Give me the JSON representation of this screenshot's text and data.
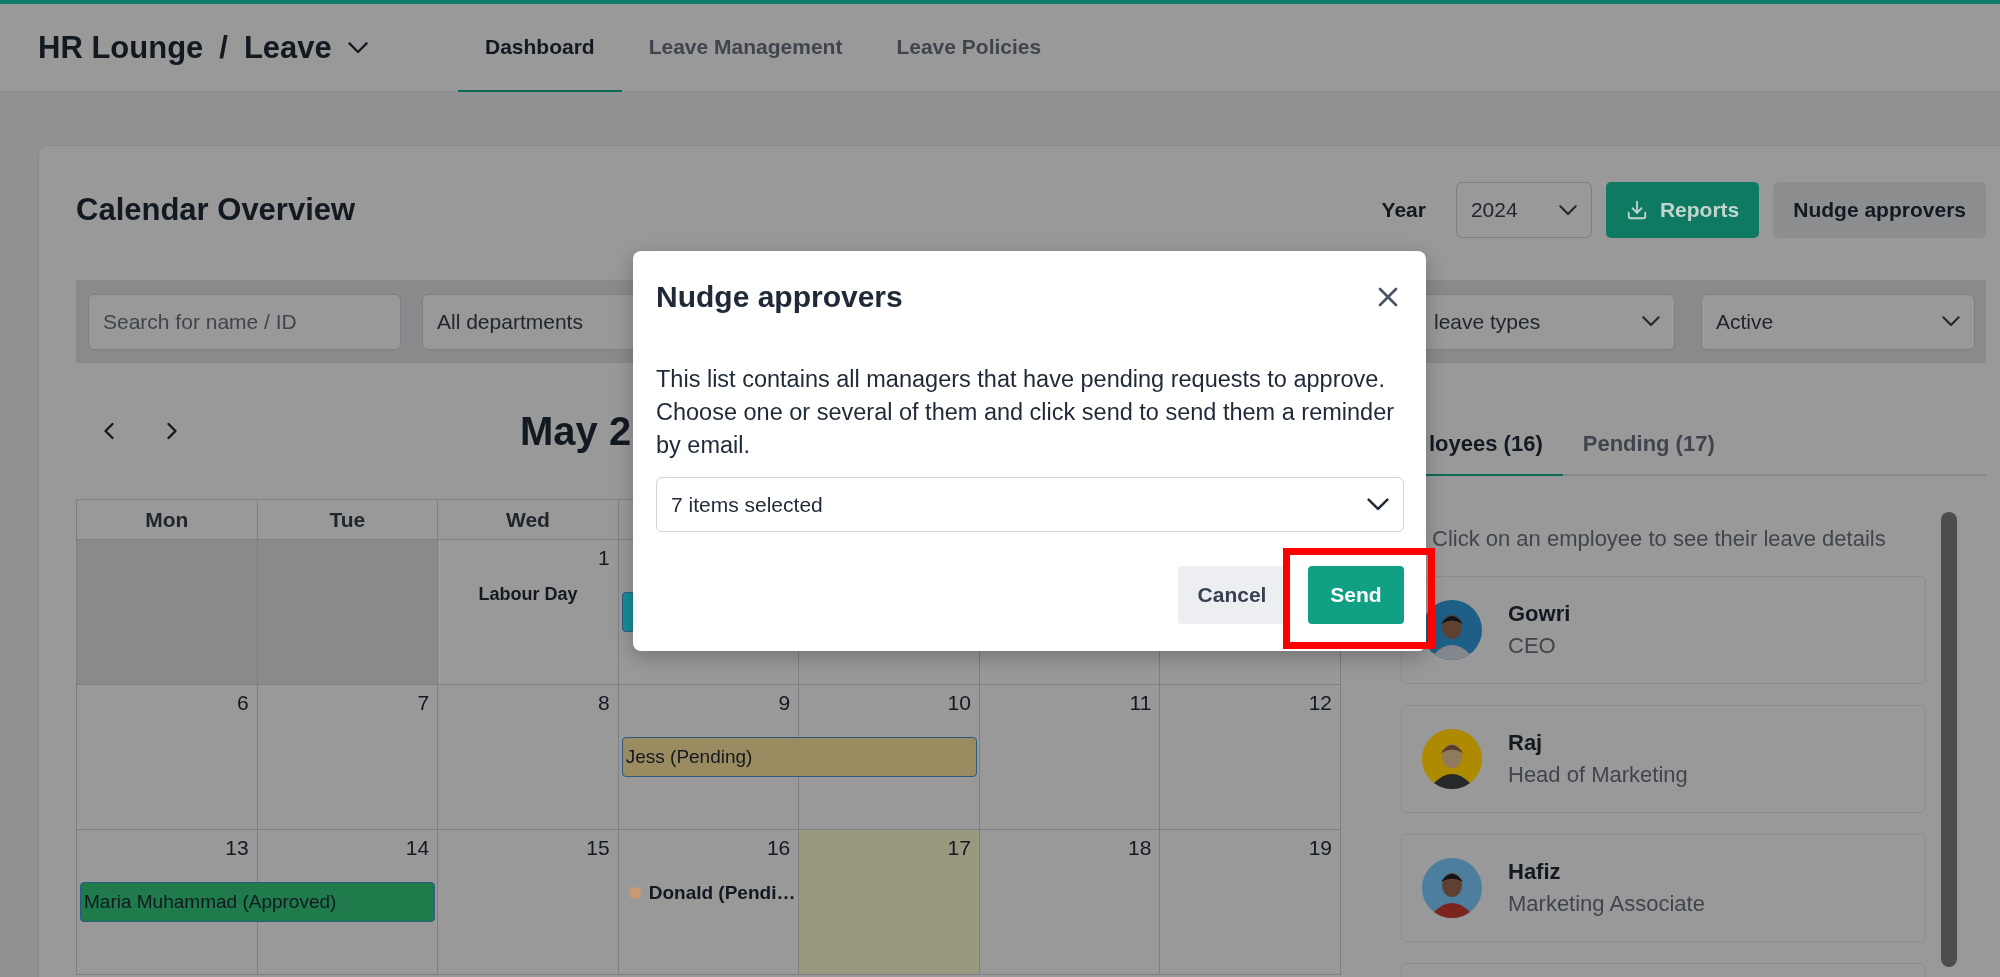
{
  "header": {
    "app": "HR Lounge",
    "separator": "/",
    "module": "Leave"
  },
  "tabs": [
    {
      "label": "Dashboard",
      "selected": true
    },
    {
      "label": "Leave Management",
      "selected": false
    },
    {
      "label": "Leave Policies",
      "selected": false
    }
  ],
  "card": {
    "title": "Calendar Overview",
    "year_label": "Year",
    "year": "2024",
    "reports_button": "Reports",
    "nudge_button": "Nudge approvers"
  },
  "filters": {
    "search": {
      "placeholder": "Search for name / ID"
    },
    "department": "All departments",
    "leave_type": "leave types",
    "status": "Active"
  },
  "calendar": {
    "title": "May 2",
    "weekdays": [
      "Mon",
      "Tue",
      "Wed"
    ],
    "weeks": [
      {
        "days": [
          {
            "muted": true,
            "today": false
          },
          {
            "muted": true,
            "today": false
          },
          {
            "number": "1",
            "muted": false,
            "today": false,
            "events": [
              {
                "kind": "holiday",
                "label": "Labour Day"
              }
            ]
          },
          {
            "muted": false,
            "today": false,
            "events": [
              {
                "kind": "bar",
                "wide": false,
                "color": "#168e9a"
              }
            ]
          },
          {
            "muted": false,
            "today": false
          },
          {
            "muted": false,
            "today": false
          },
          {
            "muted": false,
            "today": false
          }
        ]
      },
      {
        "days": [
          {
            "number": "6",
            "muted": false,
            "today": false
          },
          {
            "number": "7",
            "muted": false,
            "today": false
          },
          {
            "number": "8",
            "muted": false,
            "today": false
          },
          {
            "number": "9",
            "muted": false,
            "today": false,
            "events": [
              {
                "kind": "bar",
                "wide": true,
                "label": "Jess (Pending)",
                "color": "#9a8c60"
              }
            ]
          },
          {
            "number": "10",
            "muted": false,
            "today": false
          },
          {
            "number": "11",
            "muted": false,
            "today": false
          },
          {
            "number": "12",
            "muted": false,
            "today": false
          }
        ]
      },
      {
        "days": [
          {
            "number": "13",
            "muted": false,
            "today": false,
            "events": [
              {
                "kind": "bar",
                "wide": true,
                "label": "Maria Muhammad (Approved)",
                "color": "#1f7a4c"
              }
            ]
          },
          {
            "number": "14",
            "muted": false,
            "today": false
          },
          {
            "number": "15",
            "muted": false,
            "today": false
          },
          {
            "number": "16",
            "muted": false,
            "today": false,
            "events": [
              {
                "kind": "dot",
                "label": "Donald (Pendi…",
                "color": "#c99a74"
              }
            ]
          },
          {
            "number": "17",
            "muted": false,
            "today": true
          },
          {
            "number": "18",
            "muted": false,
            "today": false
          },
          {
            "number": "19",
            "muted": false,
            "today": false
          }
        ]
      }
    ]
  },
  "people": {
    "tabs": [
      {
        "label": "loyees (16)",
        "selected": true
      },
      {
        "label": "Pending (17)",
        "selected": false
      }
    ],
    "hint": "Click on an employee to see their leave details",
    "employees": [
      {
        "name": "Gowri",
        "role": "CEO",
        "color": "#1d5f86"
      },
      {
        "name": "Raj",
        "role": "Head of Marketing",
        "color": "#ad8a00"
      },
      {
        "name": "Hafiz",
        "role": "Marketing Associate",
        "color": "#4d7e9e"
      }
    ]
  },
  "modal": {
    "title": "Nudge approvers",
    "text": "This list contains all managers that have pending requests to approve. Choose one or several of them and click send to send them a reminder by email.",
    "select": "7 items selected",
    "cancel": "Cancel",
    "send": "Send",
    "send_highlighted": true
  }
}
